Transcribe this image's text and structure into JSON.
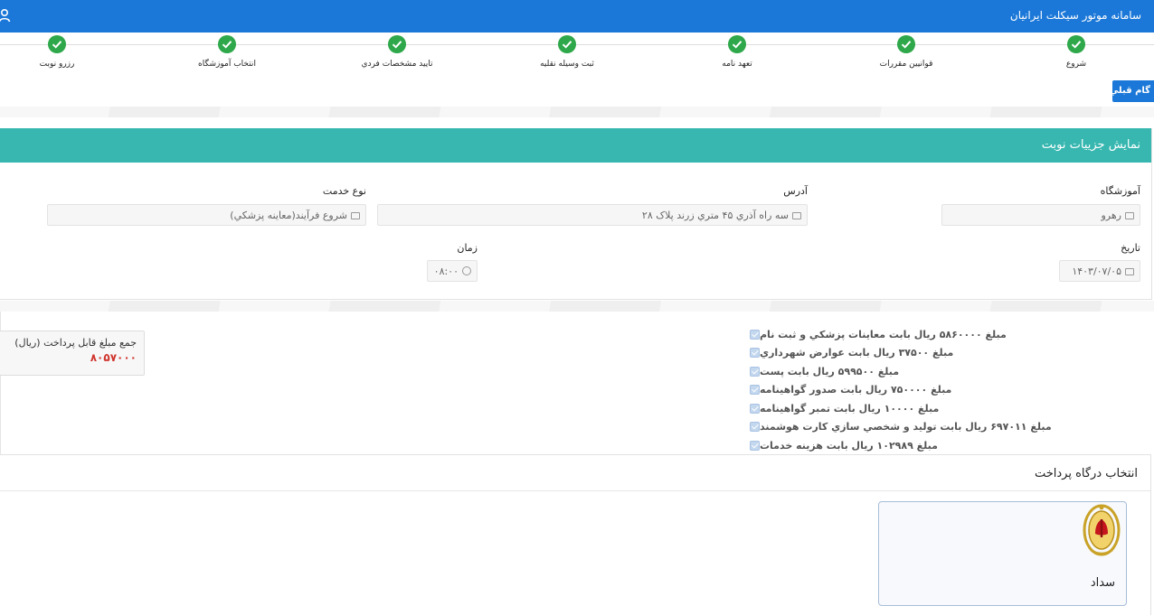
{
  "header": {
    "title": "سامانه موتور سيکلت ايرانيان",
    "user_icon": "user-icon"
  },
  "steps": [
    {
      "label": "شروع"
    },
    {
      "label": "قوانيين مقررات"
    },
    {
      "label": "تعهد نامه"
    },
    {
      "label": "ثبت وسيله نقليه"
    },
    {
      "label": "تاييد مشخصات فردي"
    },
    {
      "label": "انتخاب آموزشگاه"
    },
    {
      "label": "رزرو نوبت"
    }
  ],
  "toolbar": {
    "prev_label": "گام قبلي"
  },
  "details": {
    "title": "نمايش جزييات نوبت",
    "school_label": "آموزشگاه",
    "school_value": "رهرو",
    "address_label": "آدرس",
    "address_value": "سه راه آذري ۴۵ متري زرند پلاک ۲۸",
    "service_label": "نوع خدمت",
    "service_value": "شروع فرآيند(معاينه پزشکي)",
    "date_label": "تاريخ",
    "date_value": "۱۴۰۳/۰۷/۰۵",
    "time_label": "زمان",
    "time_value": "۰۸:۰۰"
  },
  "fees": [
    "مبلغ ۵۸۶۰۰۰۰ ريال بابت معاينات پزشکي و ثبت نام",
    "مبلغ ۳۷۵۰۰ ريال بابت عوارض شهرداري",
    "مبلغ ۵۹۹۵۰۰ ريال بابت پست",
    "مبلغ ۷۵۰۰۰۰ ريال بابت صدور گواهينامه",
    "مبلغ ۱۰۰۰۰ ريال بابت تمبر گواهينامه",
    "مبلغ ۶۹۷۰۱۱ ريال بابت توليد و شخصي سازي کارت هوشمند",
    "مبلغ ۱۰۲۹۸۹ ريال بابت هزينه خدمات"
  ],
  "total": {
    "label": "جمع مبلغ قابل پرداخت (ريال)",
    "value": "۸۰۵۷۰۰۰"
  },
  "gateway": {
    "title": "انتخاب درگاه پرداخت",
    "bank_name": "سداد"
  },
  "colors": {
    "primary": "#1b78d8",
    "teal": "#37b7b0",
    "success": "#2ea84a",
    "amount_red": "#d0342c"
  }
}
